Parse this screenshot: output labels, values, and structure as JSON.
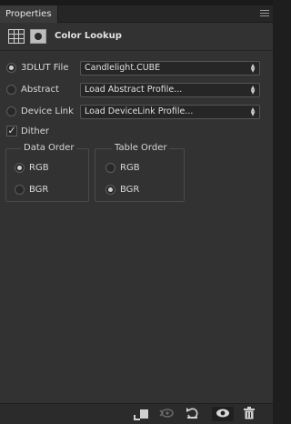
{
  "panel_tab": "Properties",
  "header": {
    "title": "Color Lookup",
    "icons": [
      "adjustment-grid-icon",
      "layer-mask-icon"
    ]
  },
  "lookup_sources": [
    {
      "label": "3DLUT File",
      "selected": true,
      "dropdown_value": "Candlelight.CUBE"
    },
    {
      "label": "Abstract",
      "selected": false,
      "dropdown_value": "Load Abstract Profile..."
    },
    {
      "label": "Device Link",
      "selected": false,
      "dropdown_value": "Load DeviceLink Profile..."
    }
  ],
  "dither": {
    "label": "Dither",
    "checked": true
  },
  "data_order": {
    "title": "Data Order",
    "options": [
      "RGB",
      "BGR"
    ],
    "selected": "RGB"
  },
  "table_order": {
    "title": "Table Order",
    "options": [
      "RGB",
      "BGR"
    ],
    "selected": "BGR"
  },
  "footer_icons": [
    "clip-to-layer-icon",
    "view-previous-state-icon",
    "reset-icon",
    "visibility-eye-icon",
    "trash-icon"
  ],
  "colors": {
    "panel_bg": "#323232",
    "field_bg": "#262626",
    "text": "#d6d6d6"
  }
}
